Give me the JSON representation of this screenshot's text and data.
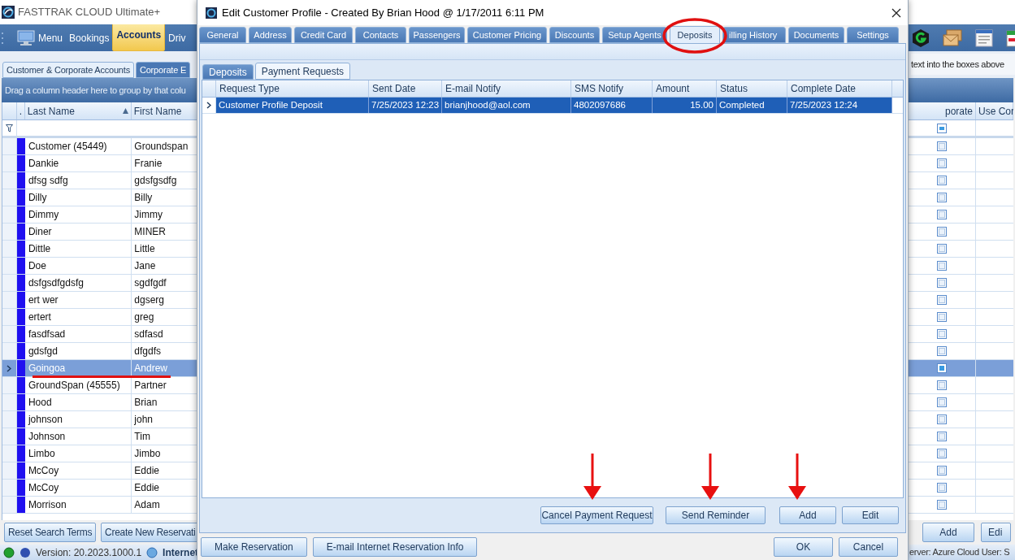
{
  "app": {
    "title": "FASTTRAK CLOUD Ultimate+",
    "nav": [
      {
        "label": "Menu",
        "selected": false,
        "kind": "menu"
      },
      {
        "label": "Bookings",
        "selected": false,
        "kind": "text"
      },
      {
        "label": "Accounts",
        "selected": true,
        "kind": "text"
      },
      {
        "label": "Driv",
        "selected": false,
        "kind": "text"
      }
    ],
    "tabs": [
      {
        "label": "Customer & Corporate Accounts",
        "selected": true
      },
      {
        "label": "Corporate E",
        "selected": false
      }
    ],
    "hint": "text into the boxes above",
    "group_panel": "Drag a column header here to group by that colu",
    "columns": [
      {
        "label": ".",
        "sorted": false
      },
      {
        "label": "Last Name",
        "sorted": true
      },
      {
        "label": "First Name",
        "sorted": false
      }
    ],
    "right_columns": [
      "porate",
      "Use Cor"
    ],
    "corporate_filter": {
      "indeterminate": true
    },
    "rows": [
      {
        "last_name": "Customer (45449)",
        "first_name": "Groundspan",
        "selected": false,
        "checked": false
      },
      {
        "last_name": "Dankie",
        "first_name": "Franie",
        "selected": false,
        "checked": false
      },
      {
        "last_name": "dfsg sdfg",
        "first_name": "gdsfgsdfg",
        "selected": false,
        "checked": false
      },
      {
        "last_name": "Dilly",
        "first_name": "Billy",
        "selected": false,
        "checked": false
      },
      {
        "last_name": "Dimmy",
        "first_name": "Jimmy",
        "selected": false,
        "checked": false
      },
      {
        "last_name": "Diner",
        "first_name": "MINER",
        "selected": false,
        "checked": false
      },
      {
        "last_name": "Dittle",
        "first_name": "Little",
        "selected": false,
        "checked": false
      },
      {
        "last_name": "Doe",
        "first_name": "Jane",
        "selected": false,
        "checked": false
      },
      {
        "last_name": "dsfgsdfgdsfg",
        "first_name": "sgdfgdf",
        "selected": false,
        "checked": false
      },
      {
        "last_name": "ert wer",
        "first_name": "dgserg",
        "selected": false,
        "checked": false
      },
      {
        "last_name": "ertert",
        "first_name": "greg",
        "selected": false,
        "checked": false
      },
      {
        "last_name": "fasdfsad",
        "first_name": "sdfasd",
        "selected": false,
        "checked": false
      },
      {
        "last_name": "gdsfgd",
        "first_name": "dfgdfs",
        "selected": false,
        "checked": false
      },
      {
        "last_name": "Goingoa",
        "first_name": "Andrew",
        "selected": true,
        "checked": false
      },
      {
        "last_name": "GroundSpan (45555)",
        "first_name": "Partner",
        "selected": false,
        "checked": false
      },
      {
        "last_name": "Hood",
        "first_name": "Brian",
        "selected": false,
        "checked": false
      },
      {
        "last_name": "johnson",
        "first_name": "john",
        "selected": false,
        "checked": false
      },
      {
        "last_name": "Johnson",
        "first_name": "Tim",
        "selected": false,
        "checked": false
      },
      {
        "last_name": "Limbo",
        "first_name": "Jimbo",
        "selected": false,
        "checked": false
      },
      {
        "last_name": "McCoy",
        "first_name": "Eddie",
        "selected": false,
        "checked": false
      },
      {
        "last_name": "McCoy",
        "first_name": "Eddie",
        "selected": false,
        "checked": false
      },
      {
        "last_name": "Morrison",
        "first_name": "Adam",
        "selected": false,
        "checked": false
      }
    ],
    "buttons_left": [
      "Reset Search Terms",
      "Create New Reservati"
    ],
    "buttons_right": [
      "Add",
      "Edi"
    ],
    "status_bar": {
      "version": "Version: 20.2023.1000.1",
      "connection": "Internet",
      "server": "erver: Azure Cloud",
      "user": "User: S"
    }
  },
  "dialog": {
    "title": "Edit Customer Profile - Created By Brian Hood @ 1/17/2011 6:11 PM",
    "tabs": [
      {
        "label": "General",
        "selected": false
      },
      {
        "label": "Address",
        "selected": false
      },
      {
        "label": "Credit Card",
        "selected": false
      },
      {
        "label": "Contacts",
        "selected": false
      },
      {
        "label": "Passengers",
        "selected": false
      },
      {
        "label": "Customer Pricing",
        "selected": false
      },
      {
        "label": "Discounts",
        "selected": false
      },
      {
        "label": "Setup Agents",
        "selected": false
      },
      {
        "label": "Deposits",
        "selected": true
      },
      {
        "label": "illing History",
        "selected": false
      },
      {
        "label": "Documents",
        "selected": false
      },
      {
        "label": "Settings",
        "selected": false
      }
    ],
    "subtabs": [
      {
        "label": "Deposits",
        "selected": false
      },
      {
        "label": "Payment Requests",
        "selected": true
      }
    ],
    "columns": [
      "Request Type",
      "Sent Date",
      "E-mail Notify",
      "SMS Notify",
      "Amount",
      "Status",
      "Complete Date"
    ],
    "rows": [
      {
        "cells": [
          "Customer Profile Deposit",
          "7/25/2023 12:23",
          "brianjhood@aol.com",
          "4802097686",
          "15.00",
          "Completed",
          "7/25/2023 12:24"
        ],
        "selected": true
      }
    ],
    "actions": [
      "Cancel Payment Request",
      "Send Reminder",
      "Add",
      "Edit"
    ],
    "footer_left": [
      "Make Reservation",
      "E-mail Internet Reservation Info"
    ],
    "footer_right": [
      "OK",
      "Cancel"
    ]
  }
}
